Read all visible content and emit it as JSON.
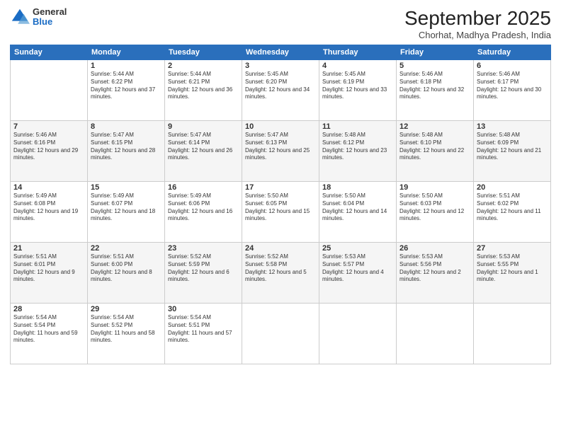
{
  "header": {
    "logo": {
      "general": "General",
      "blue": "Blue"
    },
    "title": "September 2025",
    "subtitle": "Chorhat, Madhya Pradesh, India"
  },
  "weekdays": [
    "Sunday",
    "Monday",
    "Tuesday",
    "Wednesday",
    "Thursday",
    "Friday",
    "Saturday"
  ],
  "weeks": [
    [
      {
        "day": "",
        "sunrise": "",
        "sunset": "",
        "daylight": ""
      },
      {
        "day": "1",
        "sunrise": "Sunrise: 5:44 AM",
        "sunset": "Sunset: 6:22 PM",
        "daylight": "Daylight: 12 hours and 37 minutes."
      },
      {
        "day": "2",
        "sunrise": "Sunrise: 5:44 AM",
        "sunset": "Sunset: 6:21 PM",
        "daylight": "Daylight: 12 hours and 36 minutes."
      },
      {
        "day": "3",
        "sunrise": "Sunrise: 5:45 AM",
        "sunset": "Sunset: 6:20 PM",
        "daylight": "Daylight: 12 hours and 34 minutes."
      },
      {
        "day": "4",
        "sunrise": "Sunrise: 5:45 AM",
        "sunset": "Sunset: 6:19 PM",
        "daylight": "Daylight: 12 hours and 33 minutes."
      },
      {
        "day": "5",
        "sunrise": "Sunrise: 5:46 AM",
        "sunset": "Sunset: 6:18 PM",
        "daylight": "Daylight: 12 hours and 32 minutes."
      },
      {
        "day": "6",
        "sunrise": "Sunrise: 5:46 AM",
        "sunset": "Sunset: 6:17 PM",
        "daylight": "Daylight: 12 hours and 30 minutes."
      }
    ],
    [
      {
        "day": "7",
        "sunrise": "Sunrise: 5:46 AM",
        "sunset": "Sunset: 6:16 PM",
        "daylight": "Daylight: 12 hours and 29 minutes."
      },
      {
        "day": "8",
        "sunrise": "Sunrise: 5:47 AM",
        "sunset": "Sunset: 6:15 PM",
        "daylight": "Daylight: 12 hours and 28 minutes."
      },
      {
        "day": "9",
        "sunrise": "Sunrise: 5:47 AM",
        "sunset": "Sunset: 6:14 PM",
        "daylight": "Daylight: 12 hours and 26 minutes."
      },
      {
        "day": "10",
        "sunrise": "Sunrise: 5:47 AM",
        "sunset": "Sunset: 6:13 PM",
        "daylight": "Daylight: 12 hours and 25 minutes."
      },
      {
        "day": "11",
        "sunrise": "Sunrise: 5:48 AM",
        "sunset": "Sunset: 6:12 PM",
        "daylight": "Daylight: 12 hours and 23 minutes."
      },
      {
        "day": "12",
        "sunrise": "Sunrise: 5:48 AM",
        "sunset": "Sunset: 6:10 PM",
        "daylight": "Daylight: 12 hours and 22 minutes."
      },
      {
        "day": "13",
        "sunrise": "Sunrise: 5:48 AM",
        "sunset": "Sunset: 6:09 PM",
        "daylight": "Daylight: 12 hours and 21 minutes."
      }
    ],
    [
      {
        "day": "14",
        "sunrise": "Sunrise: 5:49 AM",
        "sunset": "Sunset: 6:08 PM",
        "daylight": "Daylight: 12 hours and 19 minutes."
      },
      {
        "day": "15",
        "sunrise": "Sunrise: 5:49 AM",
        "sunset": "Sunset: 6:07 PM",
        "daylight": "Daylight: 12 hours and 18 minutes."
      },
      {
        "day": "16",
        "sunrise": "Sunrise: 5:49 AM",
        "sunset": "Sunset: 6:06 PM",
        "daylight": "Daylight: 12 hours and 16 minutes."
      },
      {
        "day": "17",
        "sunrise": "Sunrise: 5:50 AM",
        "sunset": "Sunset: 6:05 PM",
        "daylight": "Daylight: 12 hours and 15 minutes."
      },
      {
        "day": "18",
        "sunrise": "Sunrise: 5:50 AM",
        "sunset": "Sunset: 6:04 PM",
        "daylight": "Daylight: 12 hours and 14 minutes."
      },
      {
        "day": "19",
        "sunrise": "Sunrise: 5:50 AM",
        "sunset": "Sunset: 6:03 PM",
        "daylight": "Daylight: 12 hours and 12 minutes."
      },
      {
        "day": "20",
        "sunrise": "Sunrise: 5:51 AM",
        "sunset": "Sunset: 6:02 PM",
        "daylight": "Daylight: 12 hours and 11 minutes."
      }
    ],
    [
      {
        "day": "21",
        "sunrise": "Sunrise: 5:51 AM",
        "sunset": "Sunset: 6:01 PM",
        "daylight": "Daylight: 12 hours and 9 minutes."
      },
      {
        "day": "22",
        "sunrise": "Sunrise: 5:51 AM",
        "sunset": "Sunset: 6:00 PM",
        "daylight": "Daylight: 12 hours and 8 minutes."
      },
      {
        "day": "23",
        "sunrise": "Sunrise: 5:52 AM",
        "sunset": "Sunset: 5:59 PM",
        "daylight": "Daylight: 12 hours and 6 minutes."
      },
      {
        "day": "24",
        "sunrise": "Sunrise: 5:52 AM",
        "sunset": "Sunset: 5:58 PM",
        "daylight": "Daylight: 12 hours and 5 minutes."
      },
      {
        "day": "25",
        "sunrise": "Sunrise: 5:53 AM",
        "sunset": "Sunset: 5:57 PM",
        "daylight": "Daylight: 12 hours and 4 minutes."
      },
      {
        "day": "26",
        "sunrise": "Sunrise: 5:53 AM",
        "sunset": "Sunset: 5:56 PM",
        "daylight": "Daylight: 12 hours and 2 minutes."
      },
      {
        "day": "27",
        "sunrise": "Sunrise: 5:53 AM",
        "sunset": "Sunset: 5:55 PM",
        "daylight": "Daylight: 12 hours and 1 minute."
      }
    ],
    [
      {
        "day": "28",
        "sunrise": "Sunrise: 5:54 AM",
        "sunset": "Sunset: 5:54 PM",
        "daylight": "Daylight: 11 hours and 59 minutes."
      },
      {
        "day": "29",
        "sunrise": "Sunrise: 5:54 AM",
        "sunset": "Sunset: 5:52 PM",
        "daylight": "Daylight: 11 hours and 58 minutes."
      },
      {
        "day": "30",
        "sunrise": "Sunrise: 5:54 AM",
        "sunset": "Sunset: 5:51 PM",
        "daylight": "Daylight: 11 hours and 57 minutes."
      },
      {
        "day": "",
        "sunrise": "",
        "sunset": "",
        "daylight": ""
      },
      {
        "day": "",
        "sunrise": "",
        "sunset": "",
        "daylight": ""
      },
      {
        "day": "",
        "sunrise": "",
        "sunset": "",
        "daylight": ""
      },
      {
        "day": "",
        "sunrise": "",
        "sunset": "",
        "daylight": ""
      }
    ]
  ]
}
